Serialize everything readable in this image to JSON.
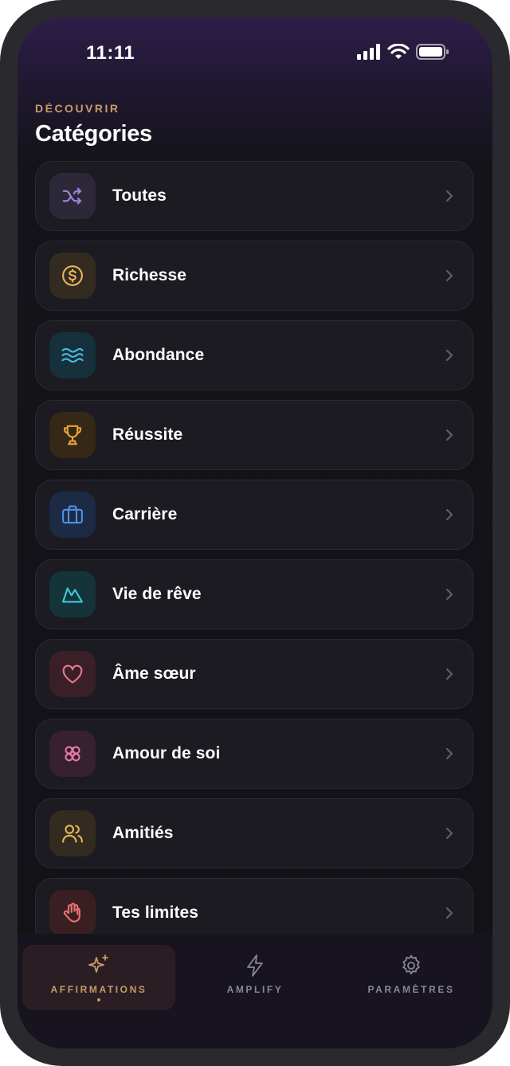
{
  "status": {
    "time": "11:11"
  },
  "header": {
    "eyebrow": "DÉCOUVRIR",
    "title": "Catégories"
  },
  "categories": [
    {
      "label": "Toutes",
      "icon": "shuffle-icon",
      "color": "#9b86e0",
      "tile": "#2d2838"
    },
    {
      "label": "Richesse",
      "icon": "dollar-coin-icon",
      "color": "#e6b45c",
      "tile": "#332a20"
    },
    {
      "label": "Abondance",
      "icon": "waves-icon",
      "color": "#4fb7e0",
      "tile": "#16303c"
    },
    {
      "label": "Réussite",
      "icon": "trophy-icon",
      "color": "#e8a23a",
      "tile": "#352816"
    },
    {
      "label": "Carrière",
      "icon": "briefcase-icon",
      "color": "#4f8fe6",
      "tile": "#1c2a43"
    },
    {
      "label": "Vie de rêve",
      "icon": "mountain-icon",
      "color": "#38c8d8",
      "tile": "#15343a"
    },
    {
      "label": "Âme sœur",
      "icon": "heart-icon",
      "color": "#e8788c",
      "tile": "#3a1f28"
    },
    {
      "label": "Amour de soi",
      "icon": "flower-icon",
      "color": "#e07aa8",
      "tile": "#37202f"
    },
    {
      "label": "Amitiés",
      "icon": "people-icon",
      "color": "#e6b45c",
      "tile": "#332a20"
    },
    {
      "label": "Tes limites",
      "icon": "hand-icon",
      "color": "#e87070",
      "tile": "#3a1f22"
    }
  ],
  "tabs": [
    {
      "label": "AFFIRMATIONS",
      "icon": "sparkles-icon",
      "active": true
    },
    {
      "label": "AMPLIFY",
      "icon": "lightning-icon",
      "active": false
    },
    {
      "label": "PARAMÈTRES",
      "icon": "gear-icon",
      "active": false
    }
  ],
  "colors": {
    "accent": "#c79b6a",
    "inactive": "#8a8794",
    "row_bg": "#1b1b21"
  }
}
